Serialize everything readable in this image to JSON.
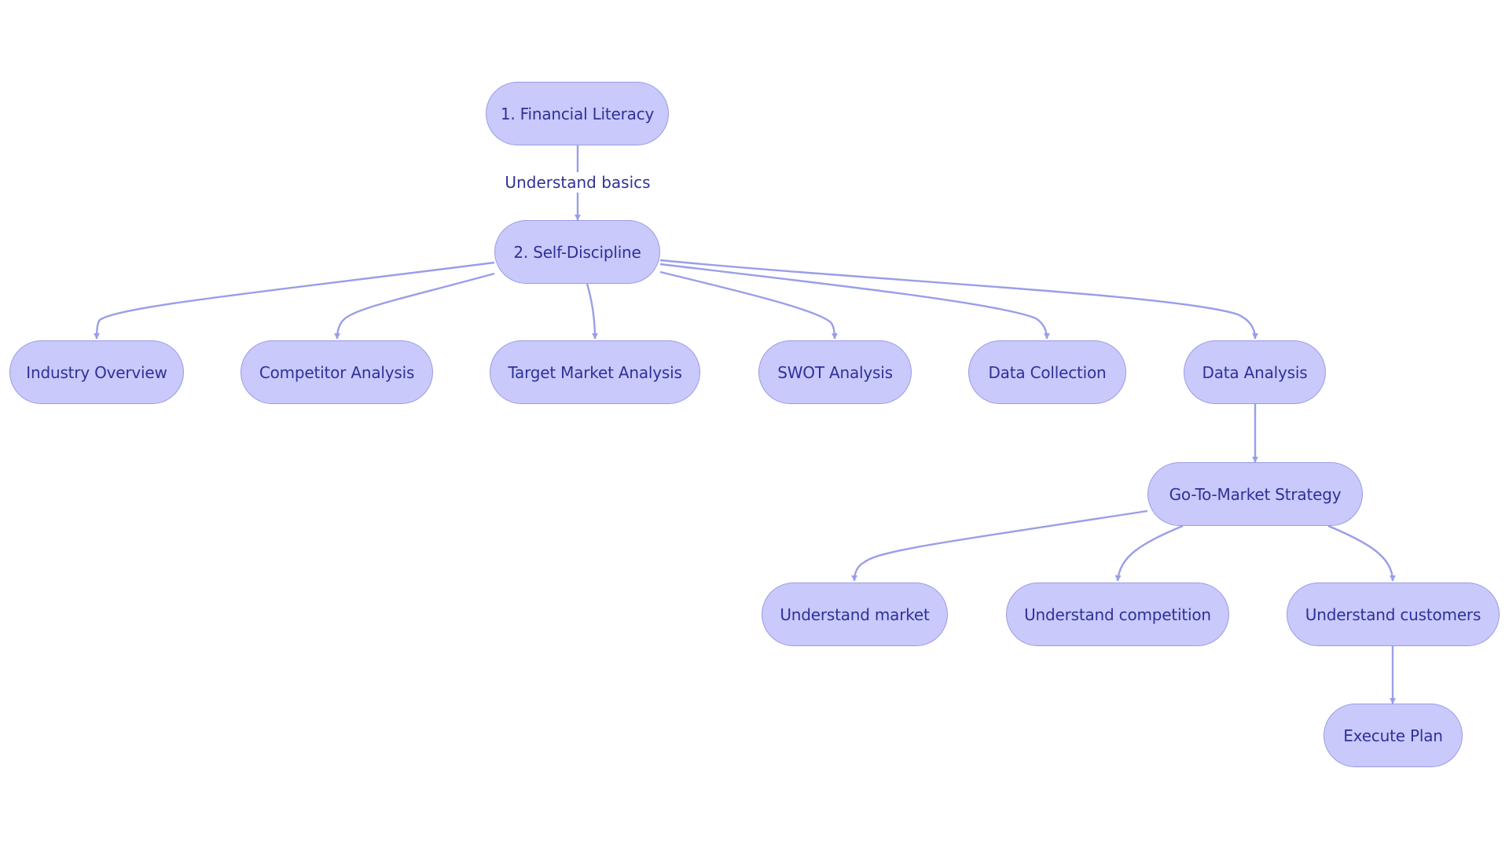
{
  "diagram": {
    "type": "flowchart",
    "colors": {
      "node_fill": "#c9c9fb",
      "node_stroke": "#9a9ce6",
      "text": "#2f3199",
      "edge": "#9a9ee8"
    },
    "nodes": [
      {
        "id": "fin",
        "label": "1. Financial Literacy"
      },
      {
        "id": "self",
        "label": "2. Self-Discipline"
      },
      {
        "id": "ind",
        "label": "Industry Overview"
      },
      {
        "id": "comp",
        "label": "Competitor Analysis"
      },
      {
        "id": "tma",
        "label": "Target Market Analysis"
      },
      {
        "id": "swot",
        "label": "SWOT Analysis"
      },
      {
        "id": "dc",
        "label": "Data Collection"
      },
      {
        "id": "da",
        "label": "Data Analysis"
      },
      {
        "id": "gtm",
        "label": "Go-To-Market Strategy"
      },
      {
        "id": "um",
        "label": "Understand market"
      },
      {
        "id": "uc",
        "label": "Understand competition"
      },
      {
        "id": "ucu",
        "label": "Understand customers"
      },
      {
        "id": "ep",
        "label": "Execute Plan"
      }
    ],
    "edges": [
      {
        "from": "fin",
        "to": "self",
        "label": "Understand basics"
      },
      {
        "from": "self",
        "to": "ind",
        "label": ""
      },
      {
        "from": "self",
        "to": "comp",
        "label": ""
      },
      {
        "from": "self",
        "to": "tma",
        "label": ""
      },
      {
        "from": "self",
        "to": "swot",
        "label": ""
      },
      {
        "from": "self",
        "to": "dc",
        "label": ""
      },
      {
        "from": "self",
        "to": "da",
        "label": ""
      },
      {
        "from": "da",
        "to": "gtm",
        "label": ""
      },
      {
        "from": "gtm",
        "to": "um",
        "label": ""
      },
      {
        "from": "gtm",
        "to": "uc",
        "label": ""
      },
      {
        "from": "gtm",
        "to": "ucu",
        "label": ""
      },
      {
        "from": "ucu",
        "to": "ep",
        "label": ""
      }
    ]
  }
}
